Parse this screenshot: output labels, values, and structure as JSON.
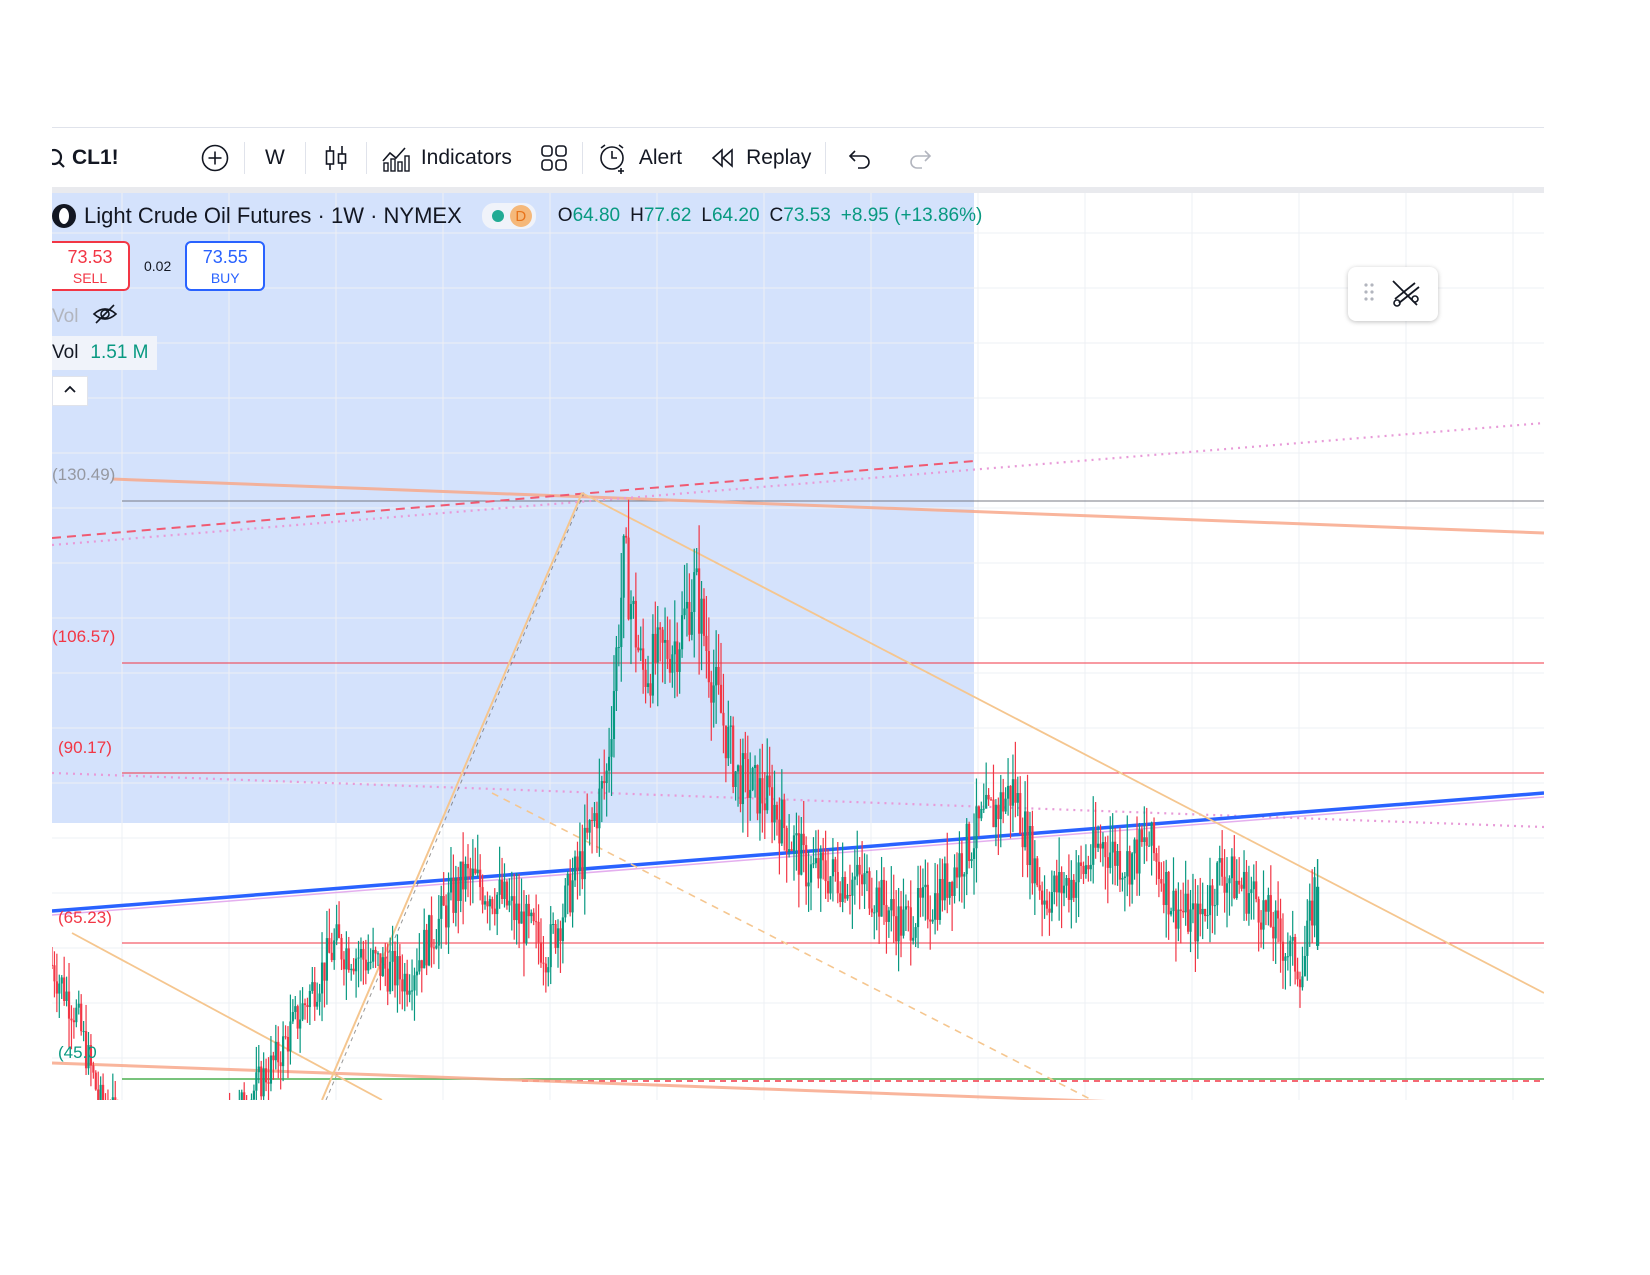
{
  "toolbar": {
    "symbol": "CL1!",
    "interval": "W",
    "indicators_label": "Indicators",
    "alert_label": "Alert",
    "replay_label": "Replay"
  },
  "legend": {
    "title": "Light Crude Oil Futures · 1W · NYMEX",
    "badge": "D",
    "open_key": "O",
    "open": "64.80",
    "high_key": "H",
    "high": "77.62",
    "low_key": "L",
    "low": "64.20",
    "close_key": "C",
    "close": "73.53",
    "change": "+8.95 (+13.86%)"
  },
  "trade": {
    "sell_price": "73.53",
    "sell_label": "SELL",
    "spread": "0.02",
    "buy_price": "73.55",
    "buy_label": "BUY"
  },
  "volume": {
    "hidden_label": "Vol",
    "label": "Vol",
    "value": "1.51 M"
  },
  "fib_levels": [
    {
      "label": "(130.49)",
      "price": 130.49
    },
    {
      "label": "(106.57)",
      "price": 106.57
    },
    {
      "label": "(90.17)",
      "price": 90.17
    },
    {
      "label": "(65.23)",
      "price": 65.23
    },
    {
      "label": "(45.0",
      "price": 45.0
    }
  ],
  "colors": {
    "up": "#089981",
    "down": "#f23645",
    "highlight_zone": "#d2e0fc",
    "trendline": "#2962ff",
    "fib_red": "#f23645",
    "fib_green": "#4caf50",
    "fan": "#f5c68f"
  },
  "chart_data": {
    "type": "candlestick",
    "price_anchors": [
      {
        "t": 0.0,
        "p": 62
      },
      {
        "t": 0.02,
        "p": 55
      },
      {
        "t": 0.04,
        "p": 42
      },
      {
        "t": 0.09,
        "p": 33
      },
      {
        "t": 0.14,
        "p": 36
      },
      {
        "t": 0.19,
        "p": 48
      },
      {
        "t": 0.24,
        "p": 65
      },
      {
        "t": 0.3,
        "p": 60
      },
      {
        "t": 0.35,
        "p": 75
      },
      {
        "t": 0.38,
        "p": 72
      },
      {
        "t": 0.42,
        "p": 64
      },
      {
        "t": 0.45,
        "p": 78
      },
      {
        "t": 0.47,
        "p": 90
      },
      {
        "t": 0.485,
        "p": 122
      },
      {
        "t": 0.5,
        "p": 105
      },
      {
        "t": 0.53,
        "p": 110
      },
      {
        "t": 0.545,
        "p": 118
      },
      {
        "t": 0.56,
        "p": 104
      },
      {
        "t": 0.58,
        "p": 90
      },
      {
        "t": 0.61,
        "p": 86
      },
      {
        "t": 0.64,
        "p": 76
      },
      {
        "t": 0.69,
        "p": 74
      },
      {
        "t": 0.72,
        "p": 68
      },
      {
        "t": 0.75,
        "p": 72
      },
      {
        "t": 0.785,
        "p": 82
      },
      {
        "t": 0.815,
        "p": 88
      },
      {
        "t": 0.84,
        "p": 72
      },
      {
        "t": 0.87,
        "p": 75
      },
      {
        "t": 0.89,
        "p": 80
      },
      {
        "t": 0.91,
        "p": 77
      },
      {
        "t": 0.93,
        "p": 80
      },
      {
        "t": 0.95,
        "p": 71
      },
      {
        "t": 0.97,
        "p": 68
      },
      {
        "t": 0.99,
        "p": 76
      },
      {
        "t": 1.02,
        "p": 72
      },
      {
        "t": 1.04,
        "p": 66
      },
      {
        "t": 1.06,
        "p": 61
      },
      {
        "t": 1.07,
        "p": 73
      }
    ]
  }
}
